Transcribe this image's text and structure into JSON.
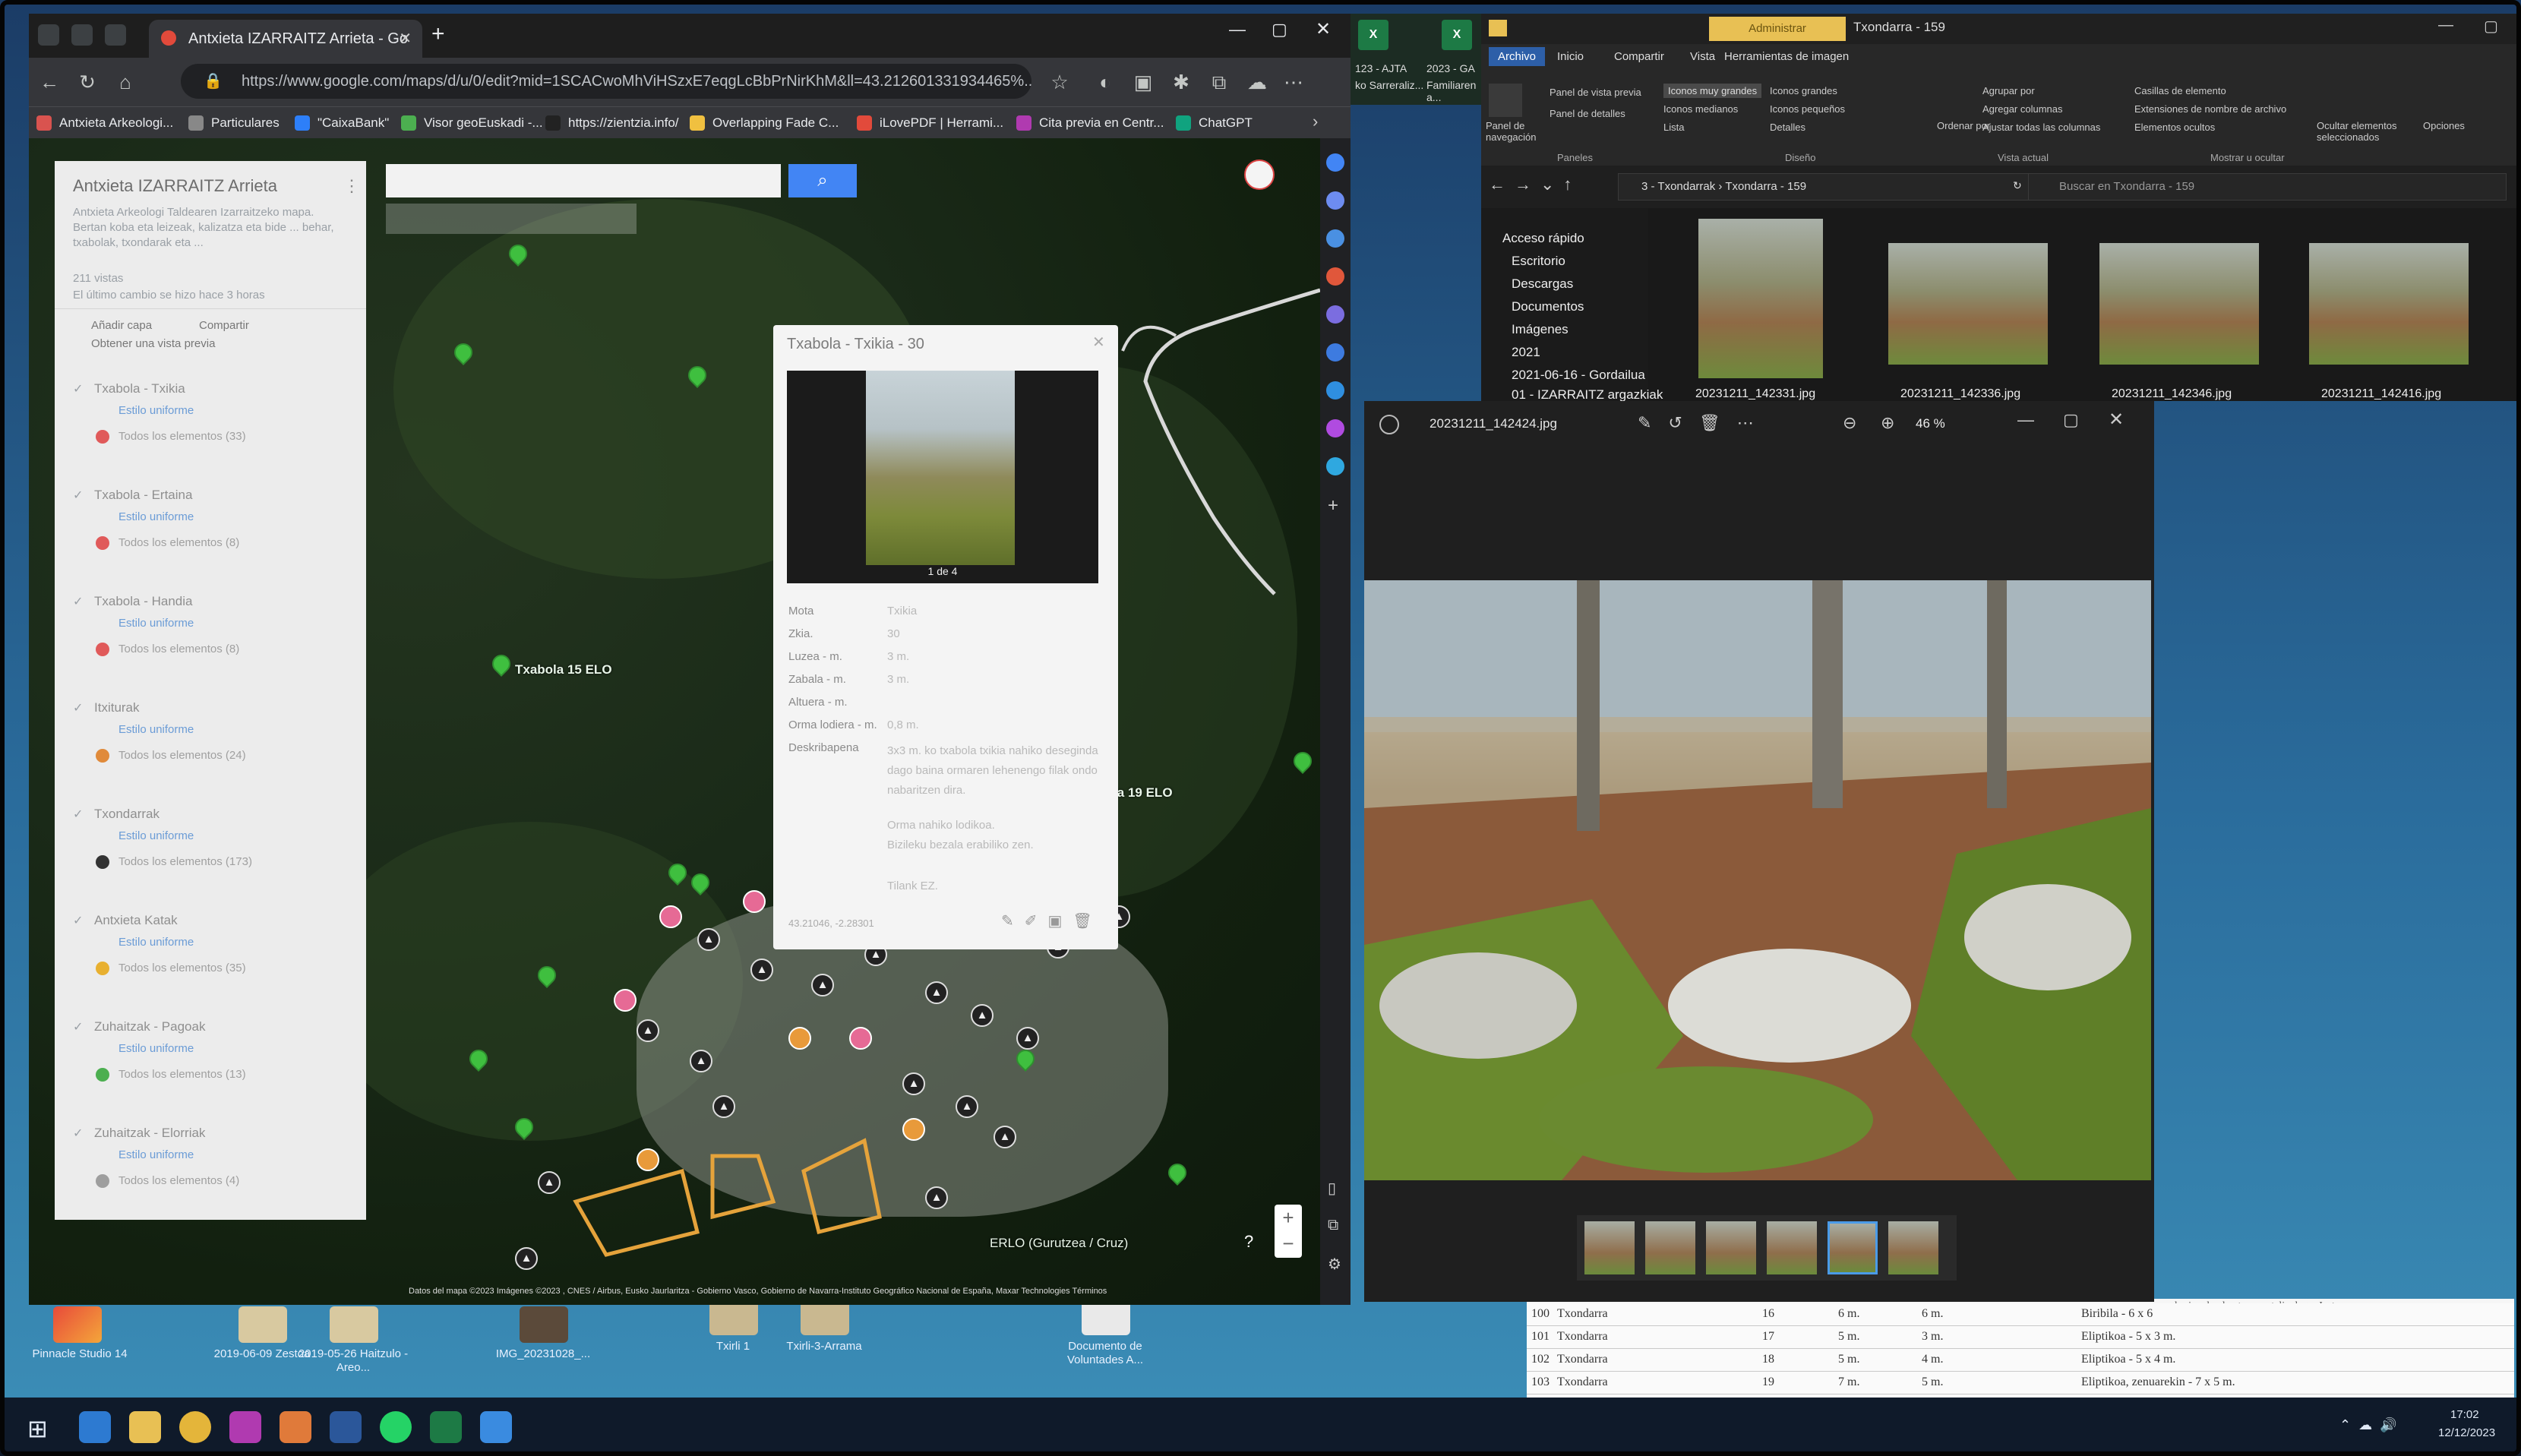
{
  "chrome": {
    "tab_title": "Antxieta IZARRAITZ Arrieta - Go",
    "url": "https://www.google.com/maps/d/u/0/edit?mid=1SCACwoMhViHSzxE7eqgLcBbPrNirKhM&ll=43.2126013319344​65%...",
    "bookmarks": [
      "Antxieta Arkeologi...",
      "Particulares",
      "\"CaixaBank\"",
      "Visor geoEuskadi -...",
      "https://zientzia.info/",
      "Overlapping Fade C...",
      "iLovePDF | Herrami...",
      "Cita previa en Centr...",
      "ChatGPT"
    ]
  },
  "map_panel": {
    "title": "Antxieta IZARRAITZ Arrieta",
    "description": "Antxieta Arkeologi Taldearen Izarraitzeko mapa. Bertan koba eta leizeak, kalizatza eta bide ... behar, txabolak, txondarak eta ...",
    "views": "211 vistas",
    "last_change": "El último cambio se hizo hace 3 horas",
    "add_layer": "Añadir capa",
    "share": "Compartir",
    "preview": "Obtener una vista previa",
    "style_label": "Estilo uniforme",
    "all_items_label": "Todos los elementos",
    "layers": [
      {
        "name": "Txabola - Txikia",
        "count": "(33)",
        "color": "#e05a5a"
      },
      {
        "name": "Txabola - Ertaina",
        "count": "(8)",
        "color": "#e05a5a"
      },
      {
        "name": "Txabola - Handia",
        "count": "(8)",
        "color": "#e05a5a"
      },
      {
        "name": "Itxiturak",
        "count": "(24)",
        "color": "#e08a3a"
      },
      {
        "name": "Txondarrak",
        "count": "(173)",
        "color": "#333333"
      },
      {
        "name": "Antxieta Katak",
        "count": "(35)",
        "color": "#e8b030"
      },
      {
        "name": "Zuhaitzak - Pagoak",
        "count": "(13)",
        "color": "#4caf50"
      },
      {
        "name": "Zuhaitzak - Elorriak",
        "count": "(4)",
        "color": "#9e9e9e"
      }
    ]
  },
  "infocard": {
    "title": "Txabola - Txikia - 30",
    "pager": "1 de 4",
    "fields": [
      {
        "k": "Mota",
        "v": "Txikia"
      },
      {
        "k": "Zkia.",
        "v": "30"
      },
      {
        "k": "Luzea - m.",
        "v": "3 m."
      },
      {
        "k": "Zabala - m.",
        "v": "3 m."
      },
      {
        "k": "Altuera - m.",
        "v": ""
      },
      {
        "k": "Orma lodiera - m.",
        "v": "0,8 m."
      },
      {
        "k": "Deskribapena",
        "v": "3x3 m. ko txabola txikia nahiko desegindа dago baina ormaren lehenengo filak ondo nabaritzen dira."
      }
    ],
    "note1": "Orma nahiko lodikoa.",
    "note2": "Bizileku bezala erabiliko zen.",
    "note3": "Tilank EZ.",
    "coords": "43.21046, -2.28301"
  },
  "map_labels": {
    "txabola_a": "Txabola 15 ELO",
    "txabola_b": "Txabola 19 ELO",
    "erlo": "ERLO (Gurutzea / Cruz)",
    "attribution": "Datos del mapa ©2023 Imágenes ©2023 , CNES / Airbus, Eusko Jaurlaritza - Gobierno Vasco, Gobierno de Navarra-Instituto Geográfico Nacional de España, Maxar Technologies    Términos"
  },
  "explorer": {
    "ribbon_tabs": [
      "Archivo",
      "Inicio",
      "Compartir",
      "Vista",
      "Herramientas de imagen"
    ],
    "manage": "Administrar",
    "window_title": "Txondarra - 159",
    "ribbon_groups": [
      "Paneles",
      "Diseño",
      "Vista actual",
      "Mostrar u ocultar"
    ],
    "ribbon_items": [
      "Panel de vista previa",
      "Panel de detalles",
      "Iconos muy grandes",
      "Iconos grandes",
      "Iconos medianos",
      "Iconos pequeños",
      "Lista",
      "Detalles",
      "Ordenar por",
      "Agrupar por",
      "Agregar columnas",
      "Ajustar todas las columnas",
      "Casillas de elemento",
      "Extensiones de nombre de archivo",
      "Elementos ocultos",
      "Ocultar elementos seleccionados",
      "Opciones",
      "Panel de navegación"
    ],
    "breadcrumb": [
      "3 - Txondarrak",
      "Txondarra - 159"
    ],
    "search_placeholder": "Buscar en Txondarra - 159",
    "nav": [
      "Acceso rápido",
      "Escritorio",
      "Descargas",
      "Documentos",
      "Imágenes",
      "2021",
      "2021-06-16 - Gordailua",
      "01 - IZARRAITZ argazkiak"
    ],
    "files": [
      "20231211_142331.jpg",
      "20231211_142336.jpg",
      "20231211_142346.jpg",
      "20231211_142416.jpg"
    ]
  },
  "excel_band": [
    "123 - AJTA",
    "2023 - GA",
    "ko Sarreraliz...",
    "Familiaren a..."
  ],
  "viewer": {
    "filename": "20231211_142424.jpg",
    "zoom": "46 %"
  },
  "sheet": {
    "note_top": "nabarian, landaretzaez estalia dago. Justu",
    "rows": [
      {
        "n": "100",
        "name": "Txondarra",
        "a": "16",
        "b": "6 m.",
        "c": "6 m.",
        "d": "Biribila - 6 x 6"
      },
      {
        "n": "101",
        "name": "Txondarra",
        "a": "17",
        "b": "5 m.",
        "c": "3 m.",
        "d": "Eliptikoa - 5 x 3 m."
      },
      {
        "n": "102",
        "name": "Txondarra",
        "a": "18",
        "b": "5 m.",
        "c": "4 m.",
        "d": "Eliptikoa - 5 x 4 m."
      },
      {
        "n": "103",
        "name": "Txondarra",
        "a": "19",
        "b": "7 m.",
        "c": "5 m.",
        "d": "Eliptikoa, zenuarekin - 7 x 5 m."
      }
    ]
  },
  "desktop": {
    "icons": [
      "Pinnacle Studio 14",
      "2019-06-09 Zestoa",
      "2019-05-26 Haitzulo - Areo...",
      "IMG_20231028_...",
      "Txirli 1",
      "Txirli-3-Arrama",
      "Documento de Voluntades A..."
    ]
  },
  "tray": {
    "time": "17:02",
    "date": "12/12/2023"
  }
}
